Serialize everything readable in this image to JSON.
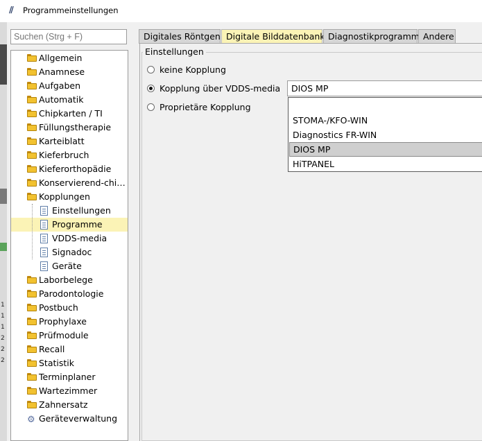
{
  "window": {
    "logo": "//",
    "title": "Programmeinstellungen"
  },
  "left_strip": {
    "marks": [
      "1",
      "1",
      "1",
      "2",
      "2",
      "2"
    ]
  },
  "search": {
    "placeholder": "Suchen (Strg + F)"
  },
  "tree": {
    "items": [
      {
        "label": "Allgemein",
        "icon": "folder-icon"
      },
      {
        "label": "Anamnese",
        "icon": "folder-icon"
      },
      {
        "label": "Aufgaben",
        "icon": "folder-icon"
      },
      {
        "label": "Automatik",
        "icon": "folder-icon"
      },
      {
        "label": "Chipkarten / TI",
        "icon": "folder-icon"
      },
      {
        "label": "Füllungstherapie",
        "icon": "folder-icon"
      },
      {
        "label": "Karteiblatt",
        "icon": "folder-icon"
      },
      {
        "label": "Kieferbruch",
        "icon": "folder-icon"
      },
      {
        "label": "Kieferorthopädie",
        "icon": "folder-icon"
      },
      {
        "label": "Konservierend-chi…",
        "icon": "folder-icon"
      },
      {
        "label": "Kopplungen",
        "icon": "folder-icon"
      },
      {
        "label": "Einstellungen",
        "icon": "document-icon"
      },
      {
        "label": "Programme",
        "icon": "document-icon",
        "selected": true
      },
      {
        "label": "VDDS-media",
        "icon": "document-icon"
      },
      {
        "label": "Signadoc",
        "icon": "document-icon"
      },
      {
        "label": "Geräte",
        "icon": "document-icon"
      },
      {
        "label": "Laborbelege",
        "icon": "folder-icon"
      },
      {
        "label": "Parodontologie",
        "icon": "folder-icon"
      },
      {
        "label": "Postbuch",
        "icon": "folder-icon"
      },
      {
        "label": "Prophylaxe",
        "icon": "folder-icon"
      },
      {
        "label": "Prüfmodule",
        "icon": "folder-icon"
      },
      {
        "label": "Recall",
        "icon": "folder-icon"
      },
      {
        "label": "Statistik",
        "icon": "folder-icon"
      },
      {
        "label": "Terminplaner",
        "icon": "folder-icon"
      },
      {
        "label": "Wartezimmer",
        "icon": "folder-icon"
      },
      {
        "label": "Zahnersatz",
        "icon": "folder-icon"
      },
      {
        "label": "Geräteverwaltung",
        "icon": "gears-icon"
      }
    ]
  },
  "tabs": [
    {
      "label": "Digitales Röntgen",
      "active": false
    },
    {
      "label": "Digitale Bilddatenbank",
      "active": true
    },
    {
      "label": "Diagnostikprogramm",
      "active": false
    },
    {
      "label": "Andere",
      "active": false
    }
  ],
  "settings": {
    "legend": "Einstellungen",
    "options": [
      {
        "label": "keine Kopplung",
        "checked": false
      },
      {
        "label": "Kopplung über VDDS-media",
        "checked": true
      },
      {
        "label": "Proprietäre Kopplung",
        "checked": false
      }
    ],
    "combo_value": "DIOS MP",
    "dropdown_options": [
      "",
      "STOMA-/KFO-WIN",
      "Diagnostics FR-WIN",
      "DIOS MP",
      "HiTPANEL"
    ],
    "dropdown_selected": "DIOS MP"
  },
  "colors": {
    "selected_highlight": "#fbf3b6",
    "folder": "#f2c230",
    "panel_bg": "#f0f0f0"
  }
}
